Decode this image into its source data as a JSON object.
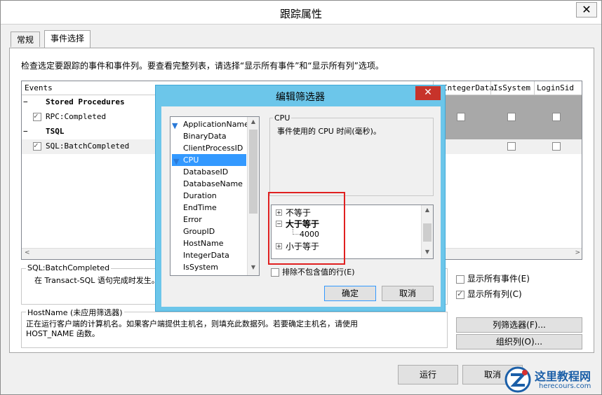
{
  "window": {
    "title": "跟踪属性",
    "close": "✕"
  },
  "tabs": [
    {
      "label": "常规"
    },
    {
      "label": "事件选择"
    }
  ],
  "description": "检查选定要跟踪的事件和事件列。要查看完整列表，请选择“显示所有事件”和“显示所有列”选项。",
  "grid": {
    "headers": [
      "Events",
      "IntegerData",
      "IsSystem",
      "LoginSid"
    ],
    "rows": [
      {
        "label": "Stored Procedures",
        "type": "group"
      },
      {
        "label": "RPC:Completed",
        "type": "event"
      },
      {
        "label": "TSQL",
        "type": "group"
      },
      {
        "label": "SQL:BatchCompleted",
        "type": "event"
      }
    ]
  },
  "event_info": {
    "title": "SQL:BatchCompleted",
    "text": "在 Transact-SQL 语句完成时发生。"
  },
  "column_info": {
    "title": "HostName (未应用筛选器)",
    "text": "正在运行客户端的计算机名。如果客户端提供主机名，则填充此数据列。若要确定主机名，请使用 HOST_NAME 函数。"
  },
  "options": {
    "show_all_events": "显示所有事件(E)",
    "show_all_columns": "显示所有列(C)",
    "column_filter": "列筛选器(F)...",
    "organize_columns": "组织列(O)..."
  },
  "footer": {
    "run": "运行",
    "cancel": "取消"
  },
  "dialog": {
    "title": "编辑筛选器",
    "close": "✕",
    "columns": [
      "ApplicationName",
      "BinaryData",
      "ClientProcessID",
      "CPU",
      "DatabaseID",
      "DatabaseName",
      "Duration",
      "EndTime",
      "Error",
      "GroupID",
      "HostName",
      "IntegerData",
      "IsSystem"
    ],
    "selected": "CPU",
    "info_title": "CPU",
    "info_text": "事件使用的 CPU 时间(毫秒)。",
    "tree": {
      "not_equal": "不等于",
      "greater_equal": "大于等于",
      "value": "4000",
      "less_equal": "小于等于"
    },
    "exclude": "排除不包含值的行(E)",
    "ok": "确定",
    "cancel": "取消"
  },
  "watermark": {
    "name": "这里教程网",
    "url": "herecours.com"
  }
}
